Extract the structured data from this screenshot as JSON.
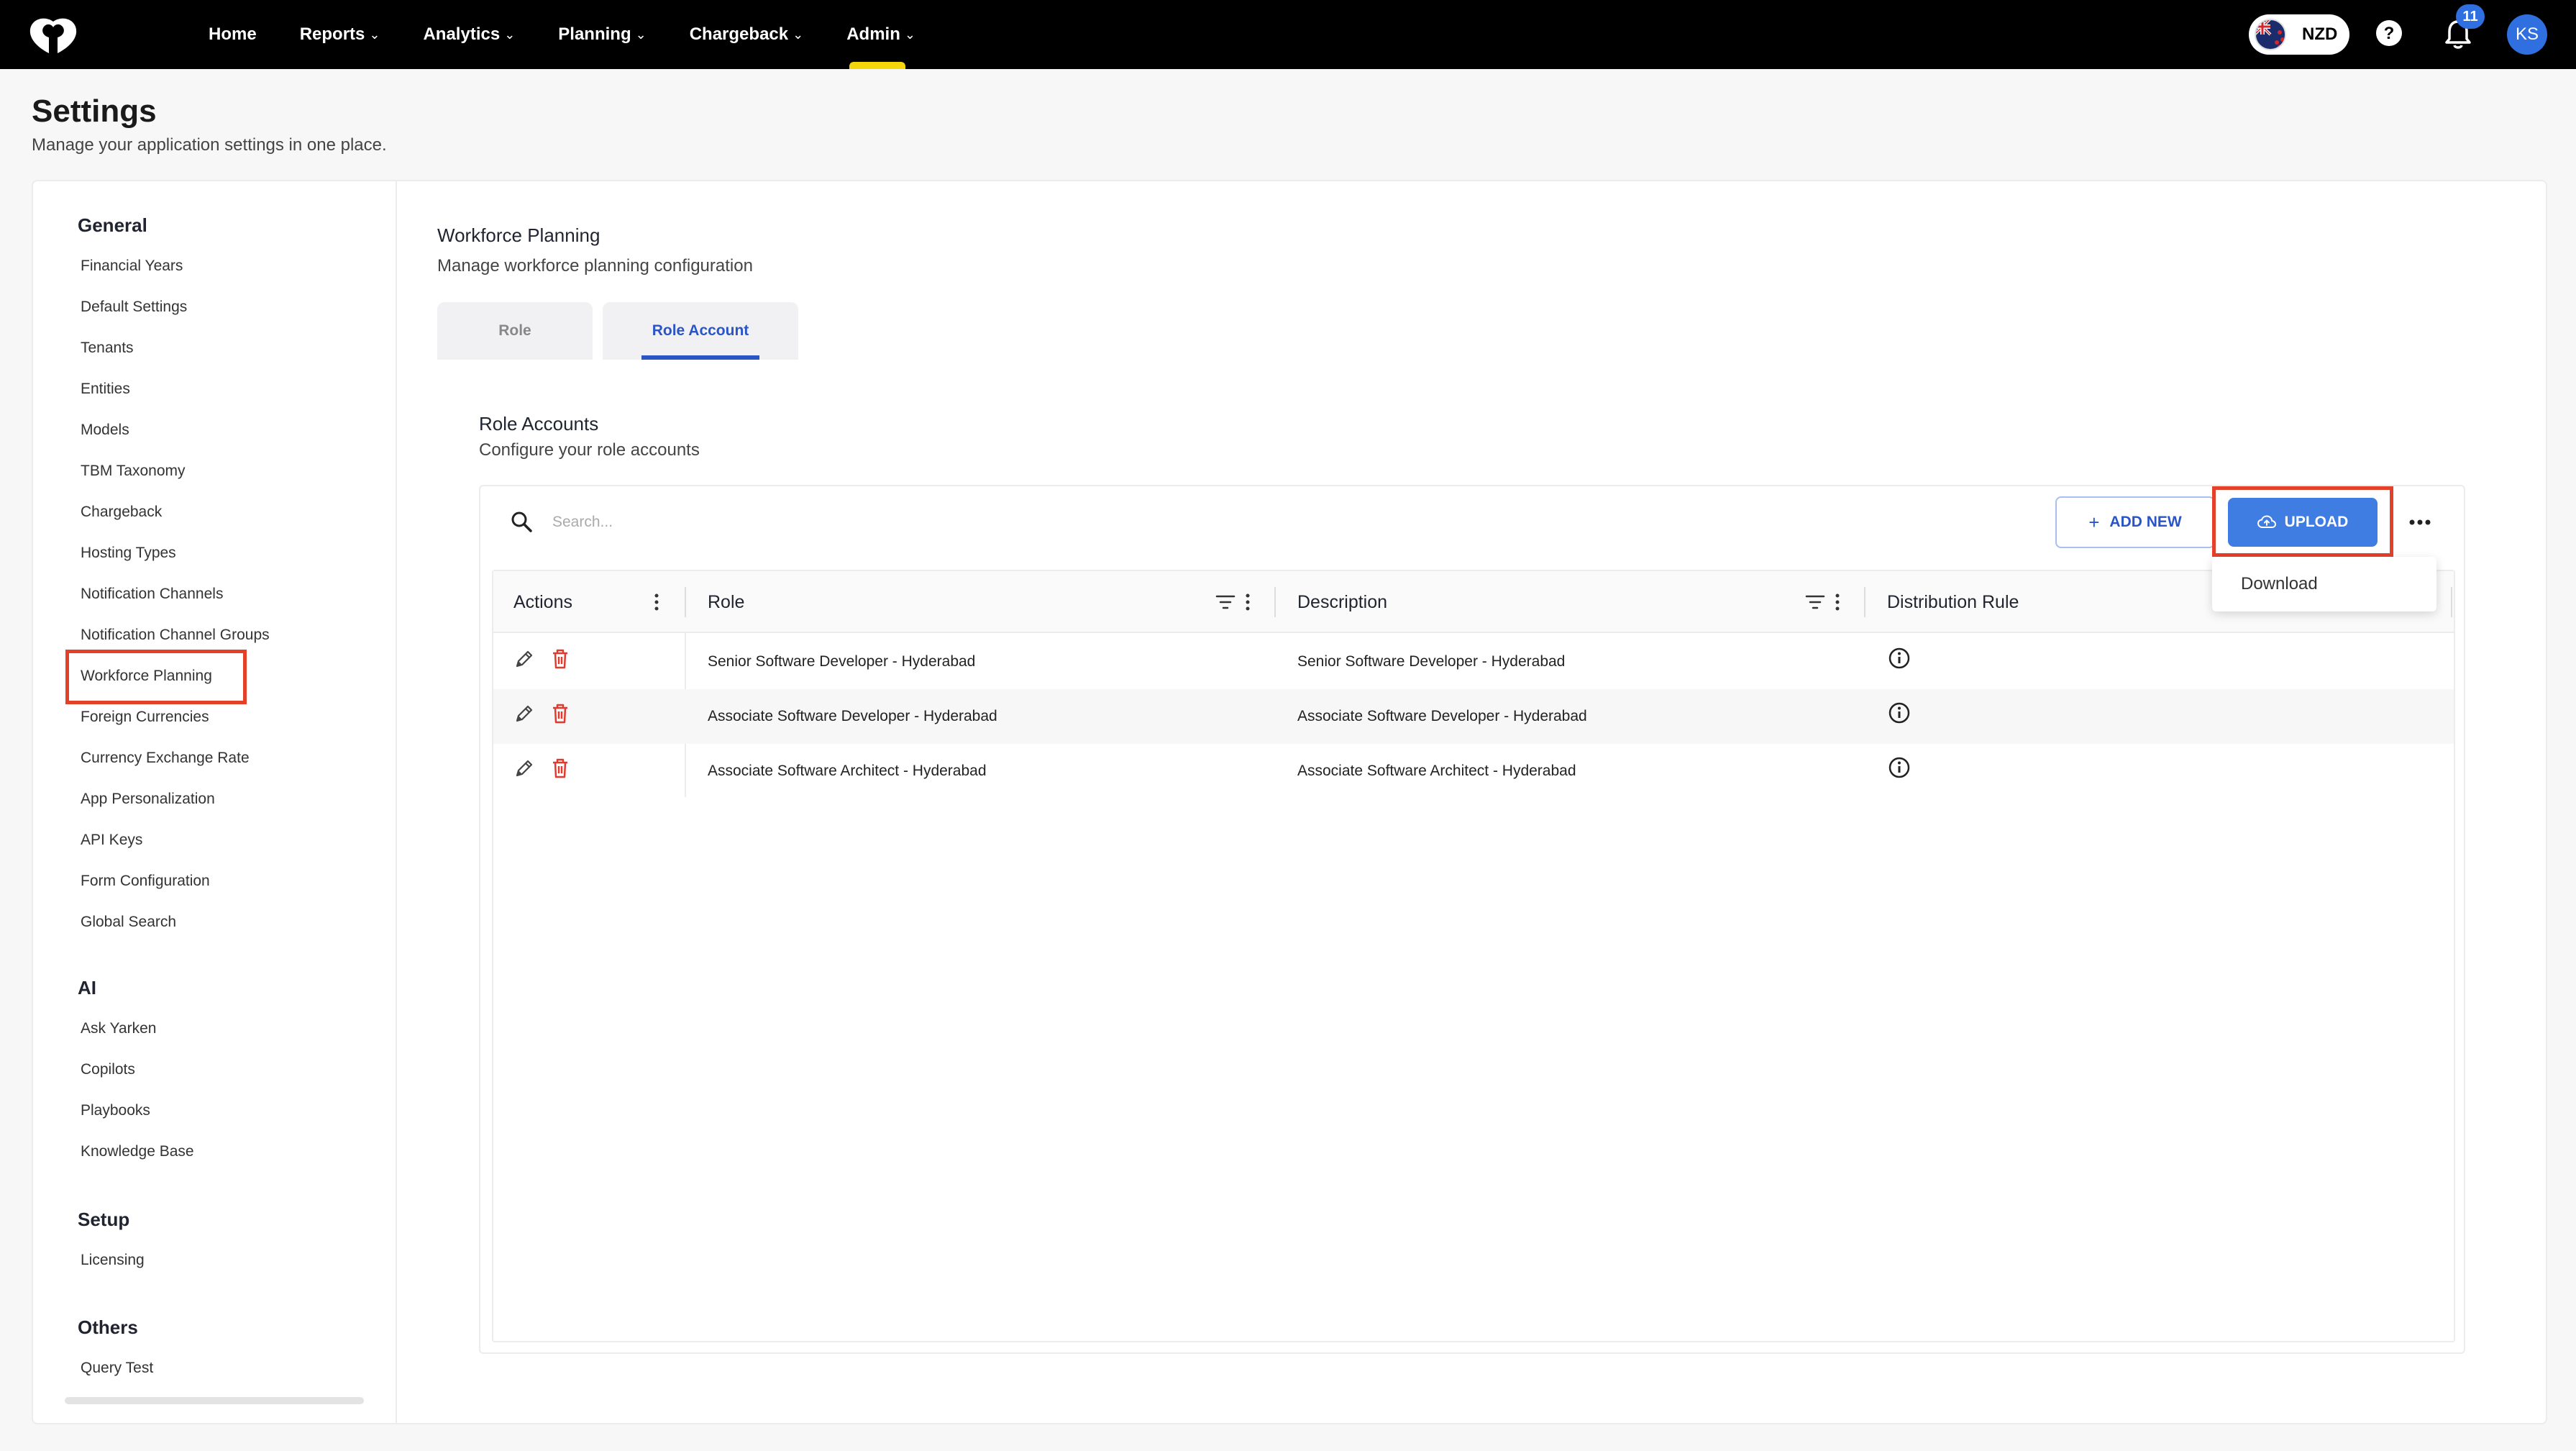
{
  "nav": {
    "items": [
      {
        "label": "Home",
        "has_menu": false
      },
      {
        "label": "Reports",
        "has_menu": true
      },
      {
        "label": "Analytics",
        "has_menu": true
      },
      {
        "label": "Planning",
        "has_menu": true
      },
      {
        "label": "Chargeback",
        "has_menu": true
      },
      {
        "label": "Admin",
        "has_menu": true,
        "active": true
      }
    ],
    "currency": "NZD",
    "notification_count": "11",
    "avatar_initials": "KS"
  },
  "page": {
    "title": "Settings",
    "subtitle": "Manage your application settings in one place."
  },
  "sidebar": {
    "groups": [
      {
        "label": "General",
        "items": [
          "Financial Years",
          "Default Settings",
          "Tenants",
          "Entities",
          "Models",
          "TBM Taxonomy",
          "Chargeback",
          "Hosting Types",
          "Notification Channels",
          "Notification Channel Groups",
          "Workforce Planning",
          "Foreign Currencies",
          "Currency Exchange Rate",
          "App Personalization",
          "API Keys",
          "Form Configuration",
          "Global Search"
        ]
      },
      {
        "label": "AI",
        "items": [
          "Ask Yarken",
          "Copilots",
          "Playbooks",
          "Knowledge Base"
        ]
      },
      {
        "label": "Setup",
        "items": [
          "Licensing"
        ]
      },
      {
        "label": "Others",
        "items": [
          "Query Test"
        ]
      }
    ],
    "selected": "Workforce Planning"
  },
  "content": {
    "title": "Workforce Planning",
    "subtitle": "Manage workforce planning configuration",
    "tabs": [
      {
        "label": "Role",
        "active": false
      },
      {
        "label": "Role Account",
        "active": true
      }
    ],
    "section_title": "Role Accounts",
    "section_subtitle": "Configure your role accounts"
  },
  "toolbar": {
    "search_placeholder": "Search...",
    "add_label": "ADD NEW",
    "upload_label": "UPLOAD",
    "dropdown_items": [
      "Download"
    ]
  },
  "table": {
    "columns": [
      "Actions",
      "Role",
      "Description",
      "Distribution Rule"
    ],
    "rows": [
      {
        "role": "Senior Software Developer - Hyderabad",
        "description": "Senior Software Developer - Hyderabad"
      },
      {
        "role": "Associate Software Developer - Hyderabad",
        "description": "Associate Software Developer - Hyderabad"
      },
      {
        "role": "Associate Software Architect - Hyderabad",
        "description": "Associate Software Architect - Hyderabad"
      }
    ]
  },
  "colors": {
    "accent": "#3f7de2",
    "tab_active": "#2a55c7",
    "highlight": "#e4412b",
    "delete": "#e03b2e",
    "nav_indicator": "#f5d60a"
  }
}
